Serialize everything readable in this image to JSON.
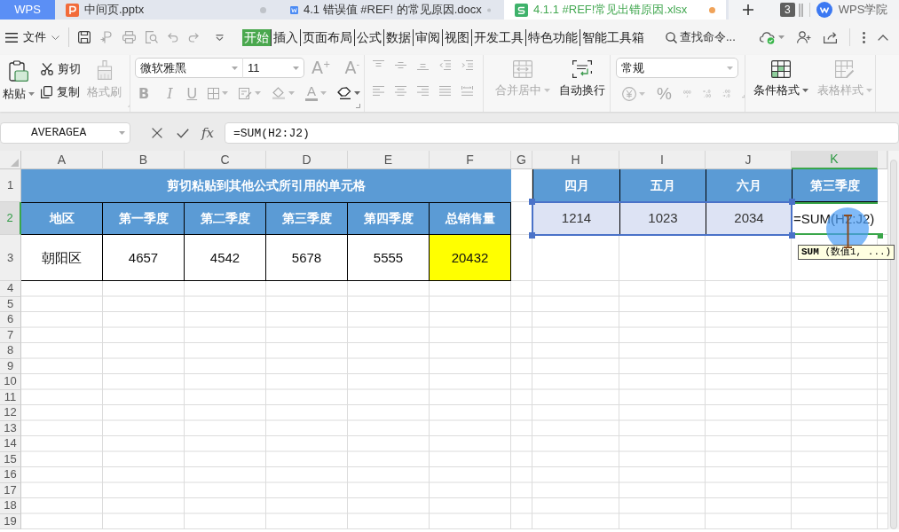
{
  "tabs": [
    {
      "kind": "home",
      "label": "WPS",
      "selected": false
    },
    {
      "kind": "presentation",
      "label": "中间页.pptx",
      "selected": false
    },
    {
      "kind": "document",
      "label": "4.1 错误值 #REF! 的常见原因.docx",
      "selected": false
    },
    {
      "kind": "spreadsheet",
      "label": "4.1.1 #REF!常见出错原因.xlsx",
      "selected": true
    }
  ],
  "window_count": "3",
  "account": "WPS学院",
  "menu": {
    "file": "文件",
    "ribbon_tabs": [
      {
        "label": "开始",
        "selected": true
      },
      {
        "label": "插入",
        "selected": false
      },
      {
        "label": "页面布局",
        "selected": false
      },
      {
        "label": "公式",
        "selected": false
      },
      {
        "label": "数据",
        "selected": false
      },
      {
        "label": "审阅",
        "selected": false
      },
      {
        "label": "视图",
        "selected": false
      },
      {
        "label": "开发工具",
        "selected": false
      },
      {
        "label": "特色功能",
        "selected": false
      },
      {
        "label": "智能工具箱",
        "selected": false
      }
    ],
    "search": {
      "placeholder": "查找命令..."
    }
  },
  "ribbon": {
    "paste": "粘贴",
    "cut": "剪切",
    "copy": "复制",
    "format_painter": {
      "label": "格式刷",
      "disabled": true
    },
    "font": {
      "name": "微软雅黑",
      "size": "11"
    },
    "font_styles": {
      "grow": "A$^{+}$",
      "shrink": "A$^{-}$",
      "bold": "B",
      "italic": "I",
      "underline": "U",
      "text_color_button": "A",
      "disabled": true
    },
    "alignment": {
      "disabled": true
    },
    "merge": {
      "label": "合并居中",
      "disabled": true
    },
    "wrap": {
      "label": "自动换行",
      "disabled": false
    },
    "number": {
      "format": "常规",
      "percent": "%",
      "disabled": true
    },
    "conditional_format": {
      "label": "条件格式",
      "disabled": false
    },
    "table_style": {
      "label": "表格样式",
      "disabled": true
    }
  },
  "formula_bar": {
    "name_box": "AVERAGEA",
    "function_button": "fx",
    "formula": "=SUM(H2:J2)"
  },
  "sheet": {
    "columns": [
      {
        "label": "A",
        "selected": false
      },
      {
        "label": "B",
        "selected": false
      },
      {
        "label": "C",
        "selected": false
      },
      {
        "label": "D",
        "selected": false
      },
      {
        "label": "E",
        "selected": false
      },
      {
        "label": "F",
        "selected": false
      },
      {
        "label": "G",
        "selected": false
      },
      {
        "label": "H",
        "selected": false
      },
      {
        "label": "I",
        "selected": false
      },
      {
        "label": "J",
        "selected": false
      },
      {
        "label": "K",
        "selected": true
      }
    ],
    "rows": [
      {
        "label": "1",
        "selected": false
      },
      {
        "label": "2",
        "selected": true
      },
      {
        "label": "3",
        "selected": false
      },
      {
        "label": "4",
        "selected": false
      },
      {
        "label": "5",
        "selected": false
      },
      {
        "label": "6",
        "selected": false
      },
      {
        "label": "7",
        "selected": false
      },
      {
        "label": "8",
        "selected": false
      },
      {
        "label": "9",
        "selected": false
      },
      {
        "label": "10",
        "selected": false
      },
      {
        "label": "11",
        "selected": false
      },
      {
        "label": "12",
        "selected": false
      },
      {
        "label": "13",
        "selected": false
      },
      {
        "label": "14",
        "selected": false
      },
      {
        "label": "15",
        "selected": false
      },
      {
        "label": "16",
        "selected": false
      },
      {
        "label": "17",
        "selected": false
      },
      {
        "label": "18",
        "selected": false
      },
      {
        "label": "19",
        "selected": false
      }
    ],
    "table_1": {
      "title": "剪切粘贴到其他公式所引用的单元格",
      "headers": [
        "地区",
        "第一季度",
        "第二季度",
        "第三季度",
        "第四季度",
        "总销售量"
      ],
      "row_3": [
        {
          "text": "朝阳区",
          "highlighted": false
        },
        {
          "text": "4657",
          "highlighted": false
        },
        {
          "text": "4542",
          "highlighted": false
        },
        {
          "text": "5678",
          "highlighted": false
        },
        {
          "text": "5555",
          "highlighted": false
        },
        {
          "text": "20432",
          "highlighted": true
        }
      ]
    },
    "table_2": {
      "headers": [
        "四月",
        "五月",
        "六月",
        "第三季度"
      ],
      "row_2": [
        {
          "text": "1214",
          "referenced": true,
          "editing": false
        },
        {
          "text": "1023",
          "referenced": true,
          "editing": false
        },
        {
          "text": "2034",
          "referenced": true,
          "editing": false
        },
        {
          "text": "=SUM(H2:J2)",
          "referenced": false,
          "editing": true
        }
      ]
    },
    "tooltip": "**SUM** (数值1, ...)"
  }
}
